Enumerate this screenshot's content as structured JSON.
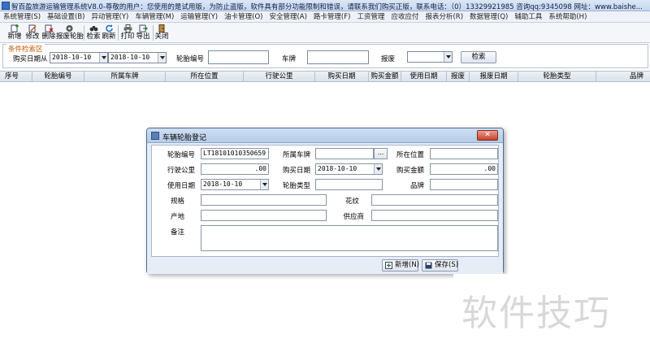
{
  "window": {
    "title": "智百盈旅游运输管理系统V8.0-尊敬的用户：您使用的是试用版，为防止盗版，软件具有部分功能限制和错误，请联系我们购买正版，联系电话：（0）13329921985  咨询qq:9345098  网址：www.baishe..."
  },
  "menu": [
    "系统管理(S)",
    "基础设置(B)",
    "异动管理(Y)",
    "车辆管理(M)",
    "运输管理(Y)",
    "油卡管理(O)",
    "安全管理(A)",
    "路卡管理(F)",
    "工资管理",
    "应收应付",
    "报表分析(R)",
    "数据管理(Q)",
    "辅助工具",
    "系统帮助(H)"
  ],
  "toolbar": {
    "new": "新增",
    "edit": "修改",
    "delete": "删除",
    "scrap": "报废轮胎",
    "search": "检索",
    "refresh": "刷新",
    "print": "打印",
    "export": "导出",
    "close": "关闭"
  },
  "search": {
    "legend": "条件检索区",
    "date_label": "购买日期从",
    "date_from": "2018-10-10",
    "date_to": "2018-10-10",
    "tire_no_label": "轮胎编号",
    "plate_label": "车牌",
    "scrap_label": "报废",
    "search_button": "检索"
  },
  "grid": {
    "columns": [
      "序号",
      "轮胎编号",
      "所属车牌",
      "所在位置",
      "行驶公里",
      "购买日期",
      "购买金额",
      "使用日期",
      "报废",
      "报废日期",
      "轮胎类型",
      "品牌"
    ]
  },
  "dialog": {
    "title": "车辆轮胎登记",
    "close": "✕",
    "labels": {
      "tire_no": "轮胎编号",
      "plate": "所属车牌",
      "position": "所在位置",
      "mileage": "行驶公里",
      "buy_date": "购买日期",
      "amount": "购买金额",
      "use_date": "使用日期",
      "tire_type": "轮胎类型",
      "brand": "品牌",
      "spec": "规格",
      "pattern": "花纹",
      "origin": "产地",
      "supplier": "供应商",
      "remark": "备注"
    },
    "values": {
      "tire_no": "LT18101010350659",
      "plate_button": "...",
      "mileage": ".00",
      "buy_date": "2018-10-10",
      "amount": ".00",
      "use_date": "2018-10-10"
    },
    "buttons": {
      "add": "新增(N)",
      "save": "保存(S)"
    }
  },
  "watermark": "软件技巧",
  "colors": {
    "accent": "#c55a00",
    "close": "#c8432b"
  }
}
